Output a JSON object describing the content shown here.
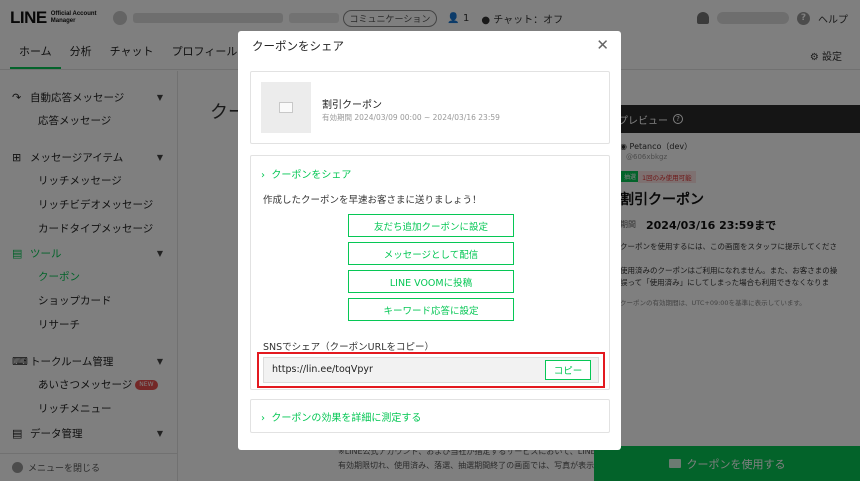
{
  "header": {
    "logo_main": "LINE",
    "logo_sub_1": "Official Account",
    "logo_sub_2": "Manager",
    "account_type": "コミュニケーション",
    "followers": "1",
    "chat_mode": "チャット：オフ",
    "help": "ヘルプ"
  },
  "nav": {
    "tabs": [
      "ホーム",
      "分析",
      "チャット",
      "プロフィール"
    ],
    "active_index": 0,
    "settings": "設定"
  },
  "sidebar": {
    "groups": [
      {
        "label": "自動応答メッセージ",
        "icon": "auto-reply-icon",
        "items": [
          "応答メッセージ"
        ]
      },
      {
        "label": "メッセージアイテム",
        "icon": "message-item-icon",
        "items": [
          "リッチメッセージ",
          "リッチビデオメッセージ",
          "カードタイプメッセージ"
        ]
      },
      {
        "label": "ツール",
        "icon": "tool-icon",
        "items": [
          "クーポン",
          "ショップカード",
          "リサーチ"
        ]
      },
      {
        "label": "トークルーム管理",
        "icon": "talkroom-icon",
        "items": [
          "あいさつメッセージ",
          "リッチメニュー"
        ]
      },
      {
        "label": "データ管理",
        "icon": "data-icon",
        "items": []
      }
    ],
    "new_badge": "NEW",
    "footer": "メニューを閉じる"
  },
  "main": {
    "page_title": "クー",
    "bg_text_1": "※LINE公式アカウント、および当社が指定するサービスにおいて、LINEお友だちクーポン",
    "bg_text_2": "有効期限切れ、使用済み、落選、抽選期間終了の画面では、写真が表示され"
  },
  "preview": {
    "title": "プレビュー",
    "account": "Petanco（dev）",
    "account_id": "@606xbkgz",
    "tag_green": "抽選",
    "tag_red": "1回のみ使用可能",
    "coupon_title": "割引クーポン",
    "period_label": "期間",
    "period": "2024/03/16 23:59まで",
    "line1": "クーポンを使用するには、この画面をスタッフに提示してくださ",
    "line2": "使用済みのクーポンはご利用になれません。また、お客さまの操",
    "line3": "誤って「使用済み」にしてしまった場合も利用できなくなりま",
    "note": "クーポンの有効期間は、UTC+09:00を基準に表示しています。",
    "use_button": "クーポンを使用する"
  },
  "modal": {
    "title": "クーポンをシェア",
    "coupon_name": "割引クーポン",
    "coupon_period": "有効期間 2024/03/09 00:00 ~ 2024/03/16 23:59",
    "share_heading": "クーポンをシェア",
    "share_desc": "作成したクーポンを早速お客さまに送りましょう！",
    "buttons": [
      "友だち追加クーポンに設定",
      "メッセージとして配信",
      "LINE VOOMに投稿",
      "キーワード応答に設定"
    ],
    "sns_label": "SNSでシェア（クーポンURLをコピー）",
    "url": "https://lin.ee/toqVpyr",
    "copy": "コピー",
    "measure": "クーポンの効果を詳細に測定する"
  },
  "colors": {
    "accent": "#06c755",
    "highlight": "#e3191f"
  }
}
